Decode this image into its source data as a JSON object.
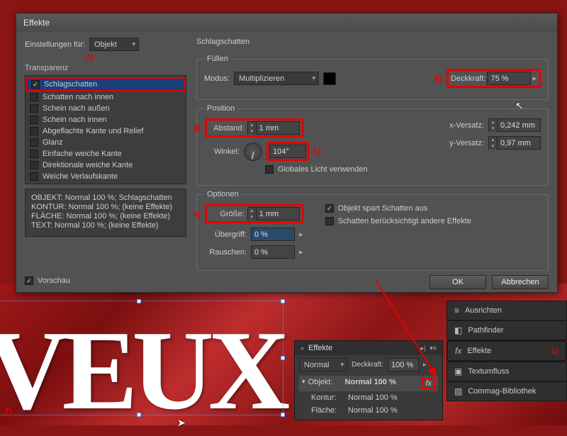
{
  "dialog": {
    "title": "Effekte",
    "settings_for_label": "Einstellungen für:",
    "settings_for_value": "Objekt",
    "heading_right": "Schlagschatten",
    "effects_group_label": "Transparenz",
    "effects": [
      {
        "label": "Schlagschatten",
        "checked": true
      },
      {
        "label": "Schatten nach innen",
        "checked": false
      },
      {
        "label": "Schein nach außen",
        "checked": false
      },
      {
        "label": "Schein nach innen",
        "checked": false
      },
      {
        "label": "Abgeflachte Kante und Relief",
        "checked": false
      },
      {
        "label": "Glanz",
        "checked": false
      },
      {
        "label": "Einfache weiche Kante",
        "checked": false
      },
      {
        "label": "Direktionale weiche Kante",
        "checked": false
      },
      {
        "label": "Weiche Verlaufskante",
        "checked": false
      }
    ],
    "summary": [
      "OBJEKT: Normal 100 %; Schlagschatten",
      "KONTUR: Normal 100 %; (keine Effekte)",
      "FLÄCHE: Normal 100 %; (keine Effekte)",
      "TEXT: Normal 100 %; (keine Effekte)"
    ],
    "preview_label": "Vorschau",
    "fill": {
      "legend": "Füllen",
      "mode_label": "Modus:",
      "mode_value": "Multiplizieren",
      "opacity_label": "Deckkraft:",
      "opacity_value": "75 %"
    },
    "position": {
      "legend": "Position",
      "distance_label": "Abstand:",
      "distance_value": "1 mm",
      "angle_label": "Winkel:",
      "angle_value": "104°",
      "global_light_label": "Globales Licht verwenden",
      "xoffset_label": "x-Versatz:",
      "xoffset_value": "0,242 mm",
      "yoffset_label": "y-Versatz:",
      "yoffset_value": "0,97 mm"
    },
    "options": {
      "legend": "Optionen",
      "size_label": "Größe:",
      "size_value": "1 mm",
      "spread_label": "Übergriff:",
      "spread_value": "0 %",
      "noise_label": "Rauschen:",
      "noise_value": "0 %",
      "knockout_label": "Objekt spart Schatten aus",
      "other_label": "Schatten berücksichtigt andere Effekte"
    },
    "ok": "OK",
    "cancel": "Abbrechen"
  },
  "side": {
    "align": "Ausrichten",
    "pathfinder": "Pathfinder",
    "effects": "Effekte",
    "textwrap": "Textumfluss",
    "commag": "Commag-Bibliothek"
  },
  "fxpanel": {
    "title": "Effekte",
    "mode": "Normal",
    "opacity_label": "Deckkraft:",
    "opacity_value": "100 %",
    "rows": [
      {
        "k": "Objekt:",
        "v": "Normal 100 %"
      },
      {
        "k": "Kontur:",
        "v": "Normal 100 %"
      },
      {
        "k": "Fläche:",
        "v": "Normal 100 %"
      }
    ]
  },
  "anno": {
    "n1": "1)",
    "n2": "2)",
    "n3": "3)",
    "n4": "4)",
    "n5": "5)",
    "n6": "6)",
    "n7": "7)",
    "fx": "fx"
  },
  "bg_text": "VEUX"
}
